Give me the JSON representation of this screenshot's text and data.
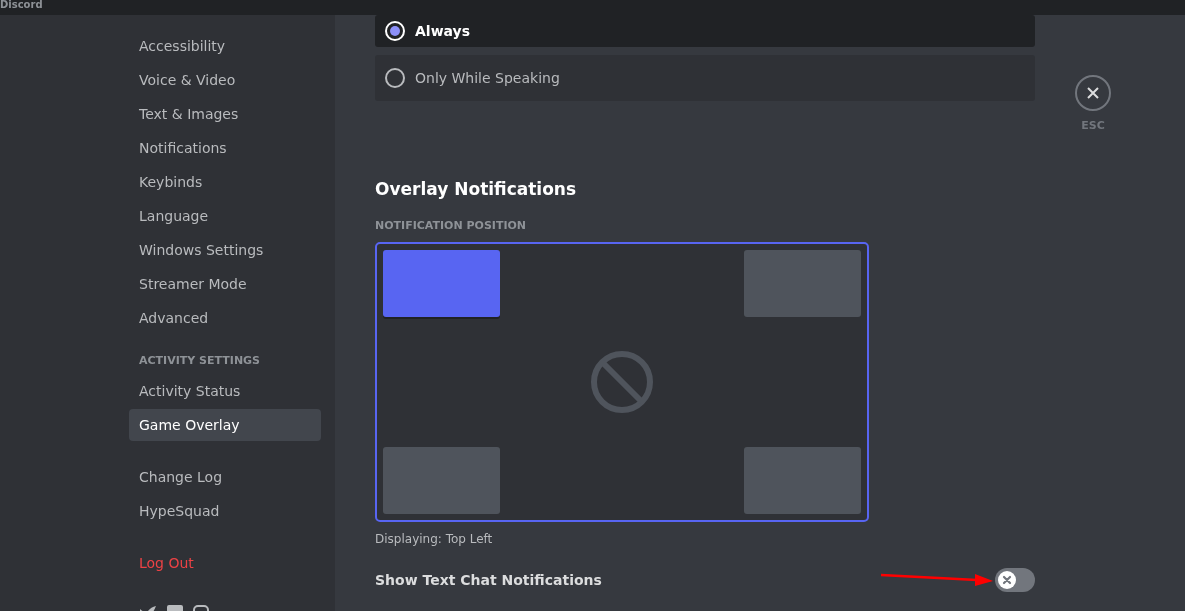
{
  "window": {
    "title": "Discord"
  },
  "sidebar": {
    "items": [
      {
        "label": "Accessibility",
        "selected": false,
        "kind": "item"
      },
      {
        "label": "Voice & Video",
        "selected": false,
        "kind": "item"
      },
      {
        "label": "Text & Images",
        "selected": false,
        "kind": "item"
      },
      {
        "label": "Notifications",
        "selected": false,
        "kind": "item"
      },
      {
        "label": "Keybinds",
        "selected": false,
        "kind": "item"
      },
      {
        "label": "Language",
        "selected": false,
        "kind": "item"
      },
      {
        "label": "Windows Settings",
        "selected": false,
        "kind": "item"
      },
      {
        "label": "Streamer Mode",
        "selected": false,
        "kind": "item"
      },
      {
        "label": "Advanced",
        "selected": false,
        "kind": "item"
      },
      {
        "label": "ACTIVITY SETTINGS",
        "kind": "header"
      },
      {
        "label": "Activity Status",
        "selected": false,
        "kind": "item"
      },
      {
        "label": "Game Overlay",
        "selected": true,
        "kind": "item"
      },
      {
        "kind": "divider"
      },
      {
        "label": "Change Log",
        "selected": false,
        "kind": "item"
      },
      {
        "label": "HypeSquad",
        "selected": false,
        "kind": "item"
      },
      {
        "kind": "divider"
      },
      {
        "label": "Log Out",
        "kind": "danger"
      },
      {
        "kind": "divider"
      },
      {
        "kind": "social"
      }
    ]
  },
  "radio_options": [
    {
      "label": "Always",
      "selected": true
    },
    {
      "label": "Only While Speaking",
      "selected": false
    }
  ],
  "section_title": "Overlay Notifications",
  "position_label": "NOTIFICATION POSITION",
  "positions": [
    {
      "kind": "top-left",
      "selected": true
    },
    {
      "kind": "top-right",
      "selected": false
    },
    {
      "kind": "bottom-left",
      "selected": false
    },
    {
      "kind": "bottom-right",
      "selected": false
    }
  ],
  "displaying": "Displaying: Top Left",
  "toggle": {
    "label": "Show Text Chat Notifications",
    "on": false
  },
  "close": {
    "label": "ESC"
  }
}
